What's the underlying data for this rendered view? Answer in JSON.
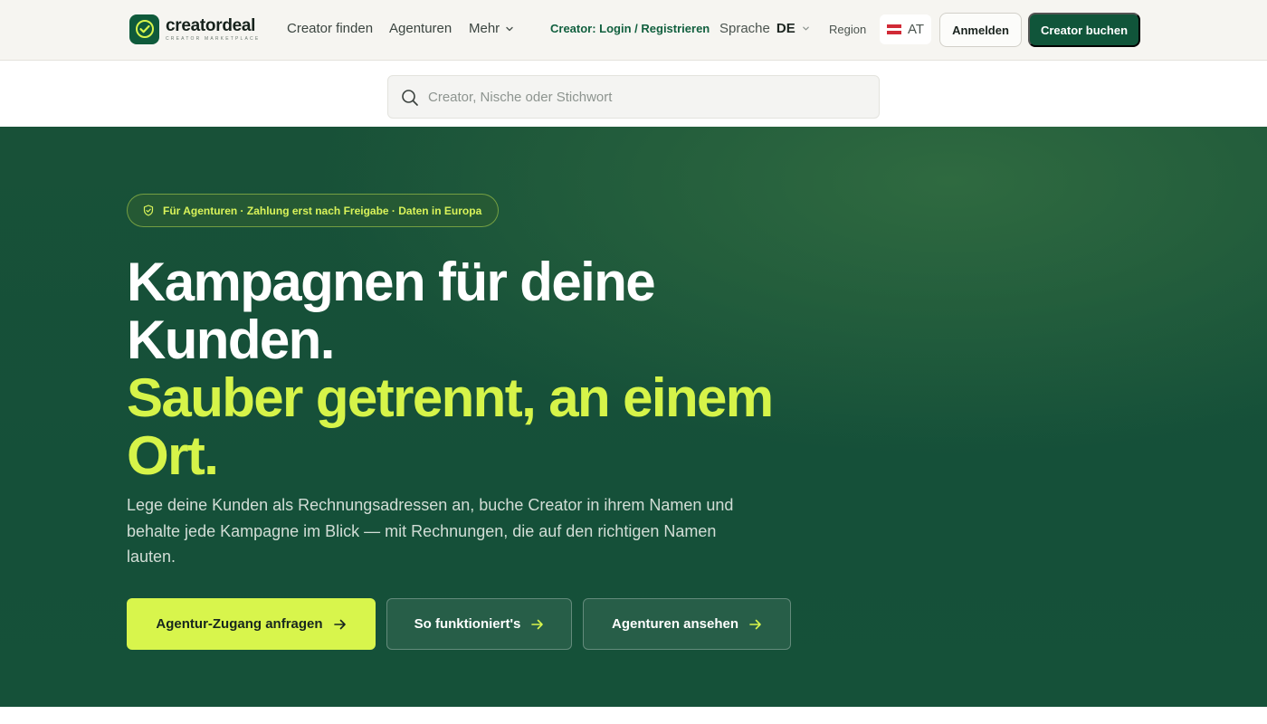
{
  "header": {
    "logo": {
      "name": "creatordeal",
      "tagline": "CREATOR MARKETPLACE"
    },
    "nav": {
      "find_creator": "Creator finden",
      "agencies": "Agenturen",
      "more": "Mehr"
    },
    "creator_login": "Creator: Login / Registrieren",
    "language": {
      "label": "Sprache",
      "value": "DE"
    },
    "region": {
      "label": "Region",
      "value": "AT"
    },
    "login_button": "Anmelden",
    "book_button": "Creator buchen"
  },
  "search": {
    "placeholder": "Creator, Nische oder Stichwort",
    "value": ""
  },
  "hero": {
    "badge": "Für Agenturen · Zahlung erst nach Freigabe · Daten in Europa",
    "title_line1": "Kampagnen für deine Kunden.",
    "title_line2": "Sauber getrennt, an einem Ort.",
    "subtitle": "Lege deine Kunden als Rechnungsadressen an, buche Creator in ihrem Namen und behalte jede Kampagne im Blick — mit Rechnungen, die auf den richtigen Namen lauten.",
    "cta_primary": "Agentur-Zugang anfragen",
    "cta_how": "So funktioniert's",
    "cta_agencies": "Agenturen ansehen"
  },
  "colors": {
    "brand_green": "#10553a",
    "accent_lime": "#d8f54c",
    "hero_background": "#155039"
  },
  "icons": {
    "logo": "check-circle-icon",
    "more": "chevron-down-icon",
    "language": "chevron-down-icon",
    "region": "austria-flag-icon",
    "search": "search-icon",
    "badge": "shield-check-icon",
    "cta": "arrow-right-icon"
  }
}
